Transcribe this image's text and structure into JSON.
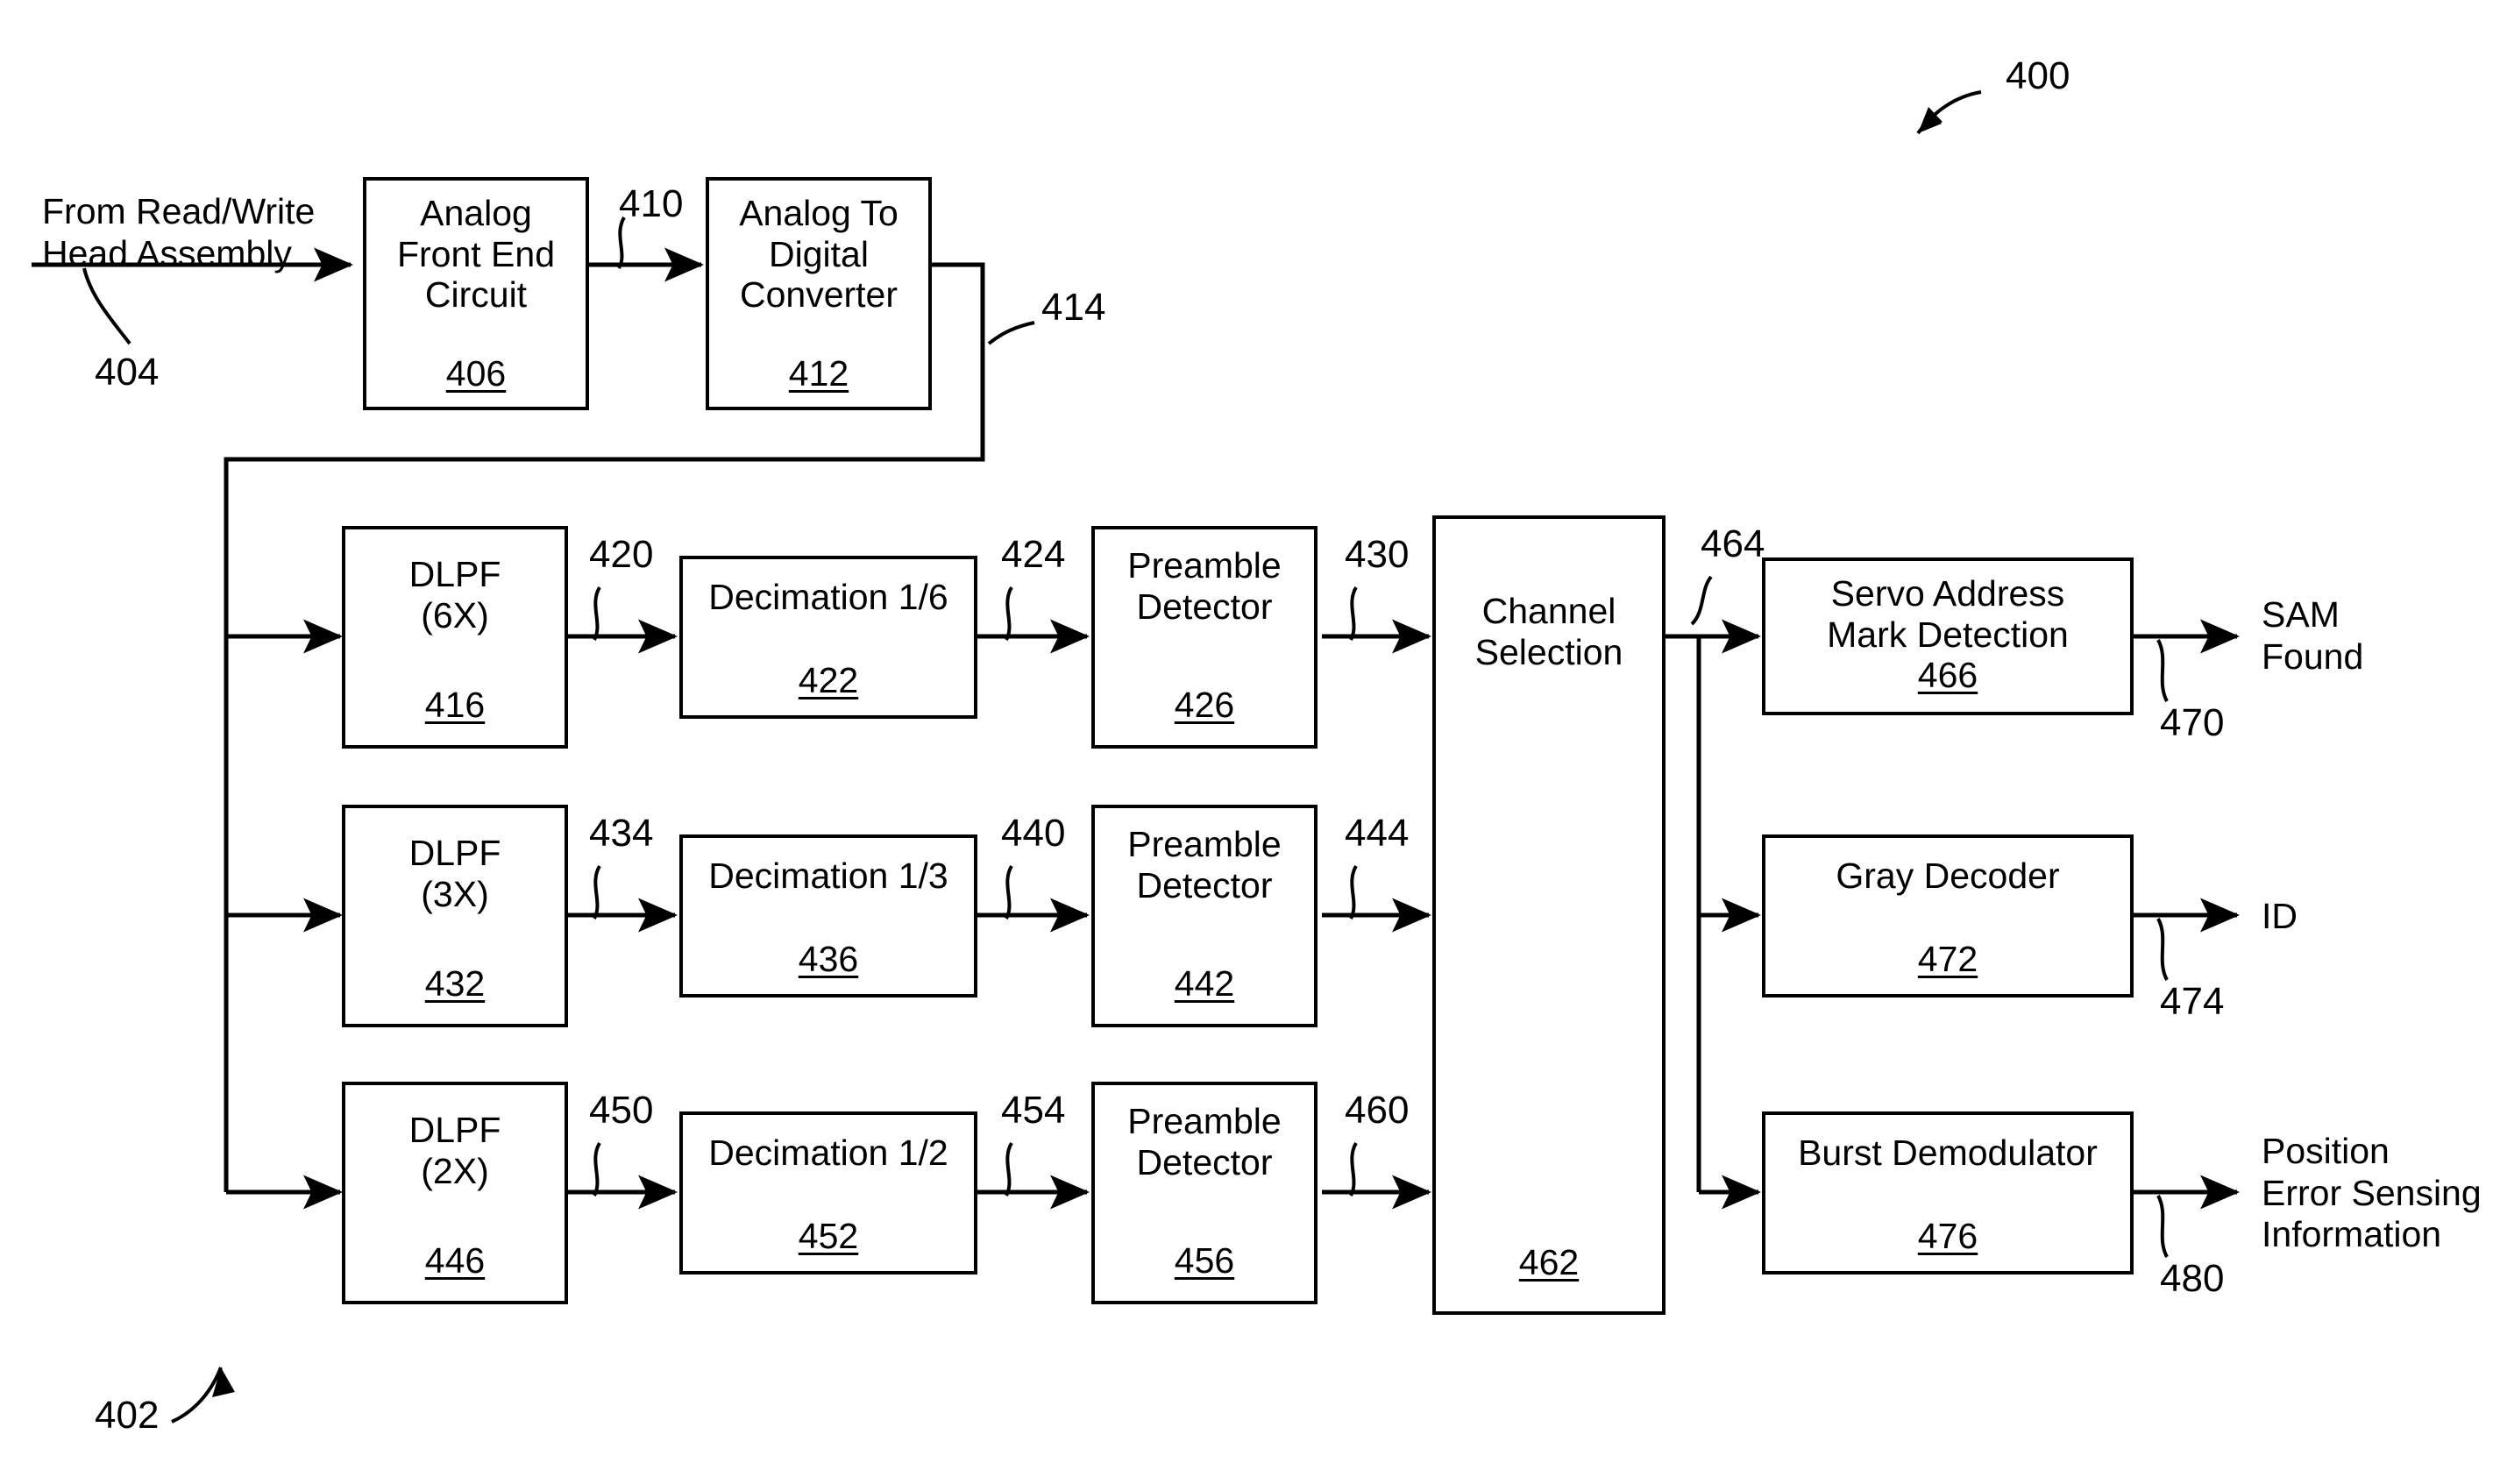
{
  "figure": {
    "figure_ref": "400",
    "subsystem_ref": "402"
  },
  "inputs": {
    "source_label": "From Read/Write\nHead Assembly",
    "source_ref": "404"
  },
  "blocks": {
    "afe": {
      "title": "Analog\nFront End\nCircuit",
      "ref": "406"
    },
    "adc": {
      "title": "Analog To\nDigital\nConverter",
      "ref": "412"
    },
    "dlpf6": {
      "title": "DLPF\n(6X)",
      "ref": "416"
    },
    "dec6": {
      "title": "Decimation 1/6",
      "ref": "422"
    },
    "pre6": {
      "title": "Preamble\nDetector",
      "ref": "426"
    },
    "dlpf3": {
      "title": "DLPF\n(3X)",
      "ref": "432"
    },
    "dec3": {
      "title": "Decimation 1/3",
      "ref": "436"
    },
    "pre3": {
      "title": "Preamble\nDetector",
      "ref": "442"
    },
    "dlpf2": {
      "title": "DLPF\n(2X)",
      "ref": "446"
    },
    "dec2": {
      "title": "Decimation 1/2",
      "ref": "452"
    },
    "pre2": {
      "title": "Preamble\nDetector",
      "ref": "456"
    },
    "chansel": {
      "title": "Channel\nSelection",
      "ref": "462"
    },
    "samdet": {
      "title": "Servo Address\nMark Detection",
      "ref": "466"
    },
    "gray": {
      "title": "Gray Decoder",
      "ref": "472"
    },
    "burst": {
      "title": "Burst Demodulator",
      "ref": "476"
    }
  },
  "signals": {
    "afe_out": "410",
    "adc_out": "414",
    "dlpf6_out": "420",
    "dec6_out": "424",
    "pre6_out": "430",
    "dlpf3_out": "434",
    "dec3_out": "440",
    "pre3_out": "444",
    "dlpf2_out": "450",
    "dec2_out": "454",
    "pre2_out": "460",
    "chansel_out": "464",
    "sam_out": "470",
    "id_out": "474",
    "pes_out": "480"
  },
  "outputs": {
    "sam_found": "SAM\nFound",
    "id": "ID",
    "pes": "Position\nError Sensing\nInformation"
  },
  "colors": {
    "line": "#000000",
    "background": "#ffffff"
  }
}
